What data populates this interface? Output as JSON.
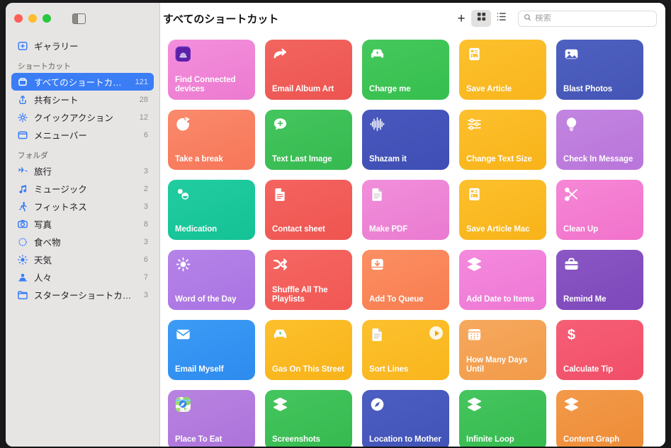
{
  "window": {
    "traffic_lights": [
      "close",
      "minimize",
      "zoom"
    ],
    "sidebar_toggle_icon": "sidebar-toggle-icon"
  },
  "toolbar": {
    "title": "すべてのショートカット",
    "add_icon": "plus-icon",
    "grid_view_icon": "grid-view-icon",
    "list_view_icon": "list-view-icon",
    "search_icon": "search-icon",
    "search_placeholder": "検索",
    "search_value": ""
  },
  "sidebar": {
    "gallery": {
      "label": "ギャラリー",
      "icon": "gallery-icon",
      "count": ""
    },
    "sections": [
      {
        "header": "ショートカット",
        "items": [
          {
            "label": "すべてのショートカット",
            "count": "121",
            "icon": "shortcuts-icon",
            "selected": true
          },
          {
            "label": "共有シート",
            "count": "28",
            "icon": "share-icon",
            "selected": false
          },
          {
            "label": "クイックアクション",
            "count": "12",
            "icon": "gear-icon",
            "selected": false
          },
          {
            "label": "メニューバー",
            "count": "6",
            "icon": "menubar-icon",
            "selected": false
          }
        ]
      },
      {
        "header": "フォルダ",
        "items": [
          {
            "label": "旅行",
            "count": "3",
            "icon": "airplane-icon",
            "selected": false
          },
          {
            "label": "ミュージック",
            "count": "2",
            "icon": "music-note-icon",
            "selected": false
          },
          {
            "label": "フィットネス",
            "count": "3",
            "icon": "running-person-icon",
            "selected": false
          },
          {
            "label": "写真",
            "count": "8",
            "icon": "camera-icon",
            "selected": false
          },
          {
            "label": "食べ物",
            "count": "3",
            "icon": "food-icon",
            "selected": false
          },
          {
            "label": "天気",
            "count": "6",
            "icon": "sun-icon",
            "selected": false
          },
          {
            "label": "人々",
            "count": "7",
            "icon": "person-icon",
            "selected": false
          },
          {
            "label": "スターターショートカット",
            "count": "3",
            "icon": "folder-icon",
            "selected": false
          }
        ]
      }
    ]
  },
  "shortcuts": [
    {
      "name": "Find Connected devices",
      "color1": "#f48fdc",
      "color2": "#ec7ad0",
      "icon": "app-badge-system",
      "badge": true,
      "running": false
    },
    {
      "name": "Email Album Art",
      "color1": "#f3655f",
      "color2": "#ec5450",
      "icon": "arrow-turn-up-right-icon",
      "badge": false,
      "running": false
    },
    {
      "name": "Charge me",
      "color1": "#45c85c",
      "color2": "#35bf4e",
      "icon": "car-charge-icon",
      "badge": false,
      "running": false
    },
    {
      "name": "Save Article",
      "color1": "#fcc12e",
      "color2": "#f9b51c",
      "icon": "article-icon",
      "badge": false,
      "running": false
    },
    {
      "name": "Blast Photos",
      "color1": "#4e60c0",
      "color2": "#4455b6",
      "icon": "photo-icon",
      "badge": false,
      "running": false
    },
    {
      "name": "Take a break",
      "color1": "#fa8a6c",
      "color2": "#f77658",
      "icon": "timer-icon",
      "badge": false,
      "running": false
    },
    {
      "name": "Text Last Image",
      "color1": "#45c55e",
      "color2": "#35ba4f",
      "icon": "message-plus-icon",
      "badge": false,
      "running": false
    },
    {
      "name": "Shazam it",
      "color1": "#4858bd",
      "color2": "#3e4eb4",
      "icon": "waveform-icon",
      "badge": false,
      "running": false
    },
    {
      "name": "Change Text Size",
      "color1": "#fcc02d",
      "color2": "#f8b318",
      "icon": "sliders-icon",
      "badge": false,
      "running": false
    },
    {
      "name": "Check In Message",
      "color1": "#c285e0",
      "color2": "#b975da",
      "icon": "lightbulb-icon",
      "badge": false,
      "running": false
    },
    {
      "name": "Medication",
      "color1": "#22cca1",
      "color2": "#13c295",
      "icon": "pills-icon",
      "badge": false,
      "running": false
    },
    {
      "name": "Contact sheet",
      "color1": "#f4645f",
      "color2": "#ef5450",
      "icon": "document-icon",
      "badge": false,
      "running": false
    },
    {
      "name": "Make PDF",
      "color1": "#f18fdb",
      "color2": "#ea7ad0",
      "icon": "document-lines-icon",
      "badge": false,
      "running": false
    },
    {
      "name": "Save Article Mac",
      "color1": "#fcc02d",
      "color2": "#f8b318",
      "icon": "article-icon",
      "badge": false,
      "running": false
    },
    {
      "name": "Clean Up",
      "color1": "#f687d6",
      "color2": "#f172cb",
      "icon": "scissors-icon",
      "badge": false,
      "running": false
    },
    {
      "name": "Word of the Day",
      "color1": "#b583e8",
      "color2": "#a973e2",
      "icon": "sun-small-icon",
      "badge": false,
      "running": false
    },
    {
      "name": "Shuffle All The Playlists",
      "color1": "#f66763",
      "color2": "#f05754",
      "icon": "shuffle-icon",
      "badge": false,
      "running": false
    },
    {
      "name": "Add To Queue",
      "color1": "#fb8f63",
      "color2": "#f87d4f",
      "icon": "tray-down-icon",
      "badge": false,
      "running": false
    },
    {
      "name": "Add Date to Items",
      "color1": "#f48ade",
      "color2": "#ee77d4",
      "icon": "layers-icon",
      "badge": false,
      "running": false
    },
    {
      "name": "Remind Me",
      "color1": "#8a57c4",
      "color2": "#7d48bb",
      "icon": "briefcase-icon",
      "badge": false,
      "running": false
    },
    {
      "name": "Email Myself",
      "color1": "#3c9bf5",
      "color2": "#2c8bee",
      "icon": "envelope-icon",
      "badge": false,
      "running": false
    },
    {
      "name": "Gas On This Street",
      "color1": "#fcc02d",
      "color2": "#f8b318",
      "icon": "car-charge-icon",
      "badge": false,
      "running": false
    },
    {
      "name": "Sort Lines",
      "color1": "#fcc12e",
      "color2": "#f9b51c",
      "icon": "document-lines-icon",
      "badge": false,
      "running": true
    },
    {
      "name": "How Many Days Until",
      "color1": "#f6a95e",
      "color2": "#f29a49",
      "icon": "calendar-icon",
      "badge": false,
      "running": false
    },
    {
      "name": "Calculate Tip",
      "color1": "#f65f76",
      "color2": "#f14e68",
      "icon": "dollar-icon",
      "badge": false,
      "running": false
    },
    {
      "name": "Place To Eat",
      "color1": "#b883e0",
      "color2": "#ac72da",
      "icon": "app-badge-maps",
      "badge": true,
      "running": false
    },
    {
      "name": "Screenshots",
      "color1": "#45c55e",
      "color2": "#35ba4f",
      "icon": "layers-icon",
      "badge": false,
      "running": false
    },
    {
      "name": "Location to Mother",
      "color1": "#4c5ec1",
      "color2": "#4253b7",
      "icon": "compass-icon",
      "badge": false,
      "running": false
    },
    {
      "name": "Infinite Loop",
      "color1": "#45c55e",
      "color2": "#35ba4f",
      "icon": "layers-icon",
      "badge": false,
      "running": false
    },
    {
      "name": "Content Graph",
      "color1": "#f29a4a",
      "color2": "#ee8b36",
      "icon": "layers-icon",
      "badge": false,
      "running": false
    }
  ]
}
